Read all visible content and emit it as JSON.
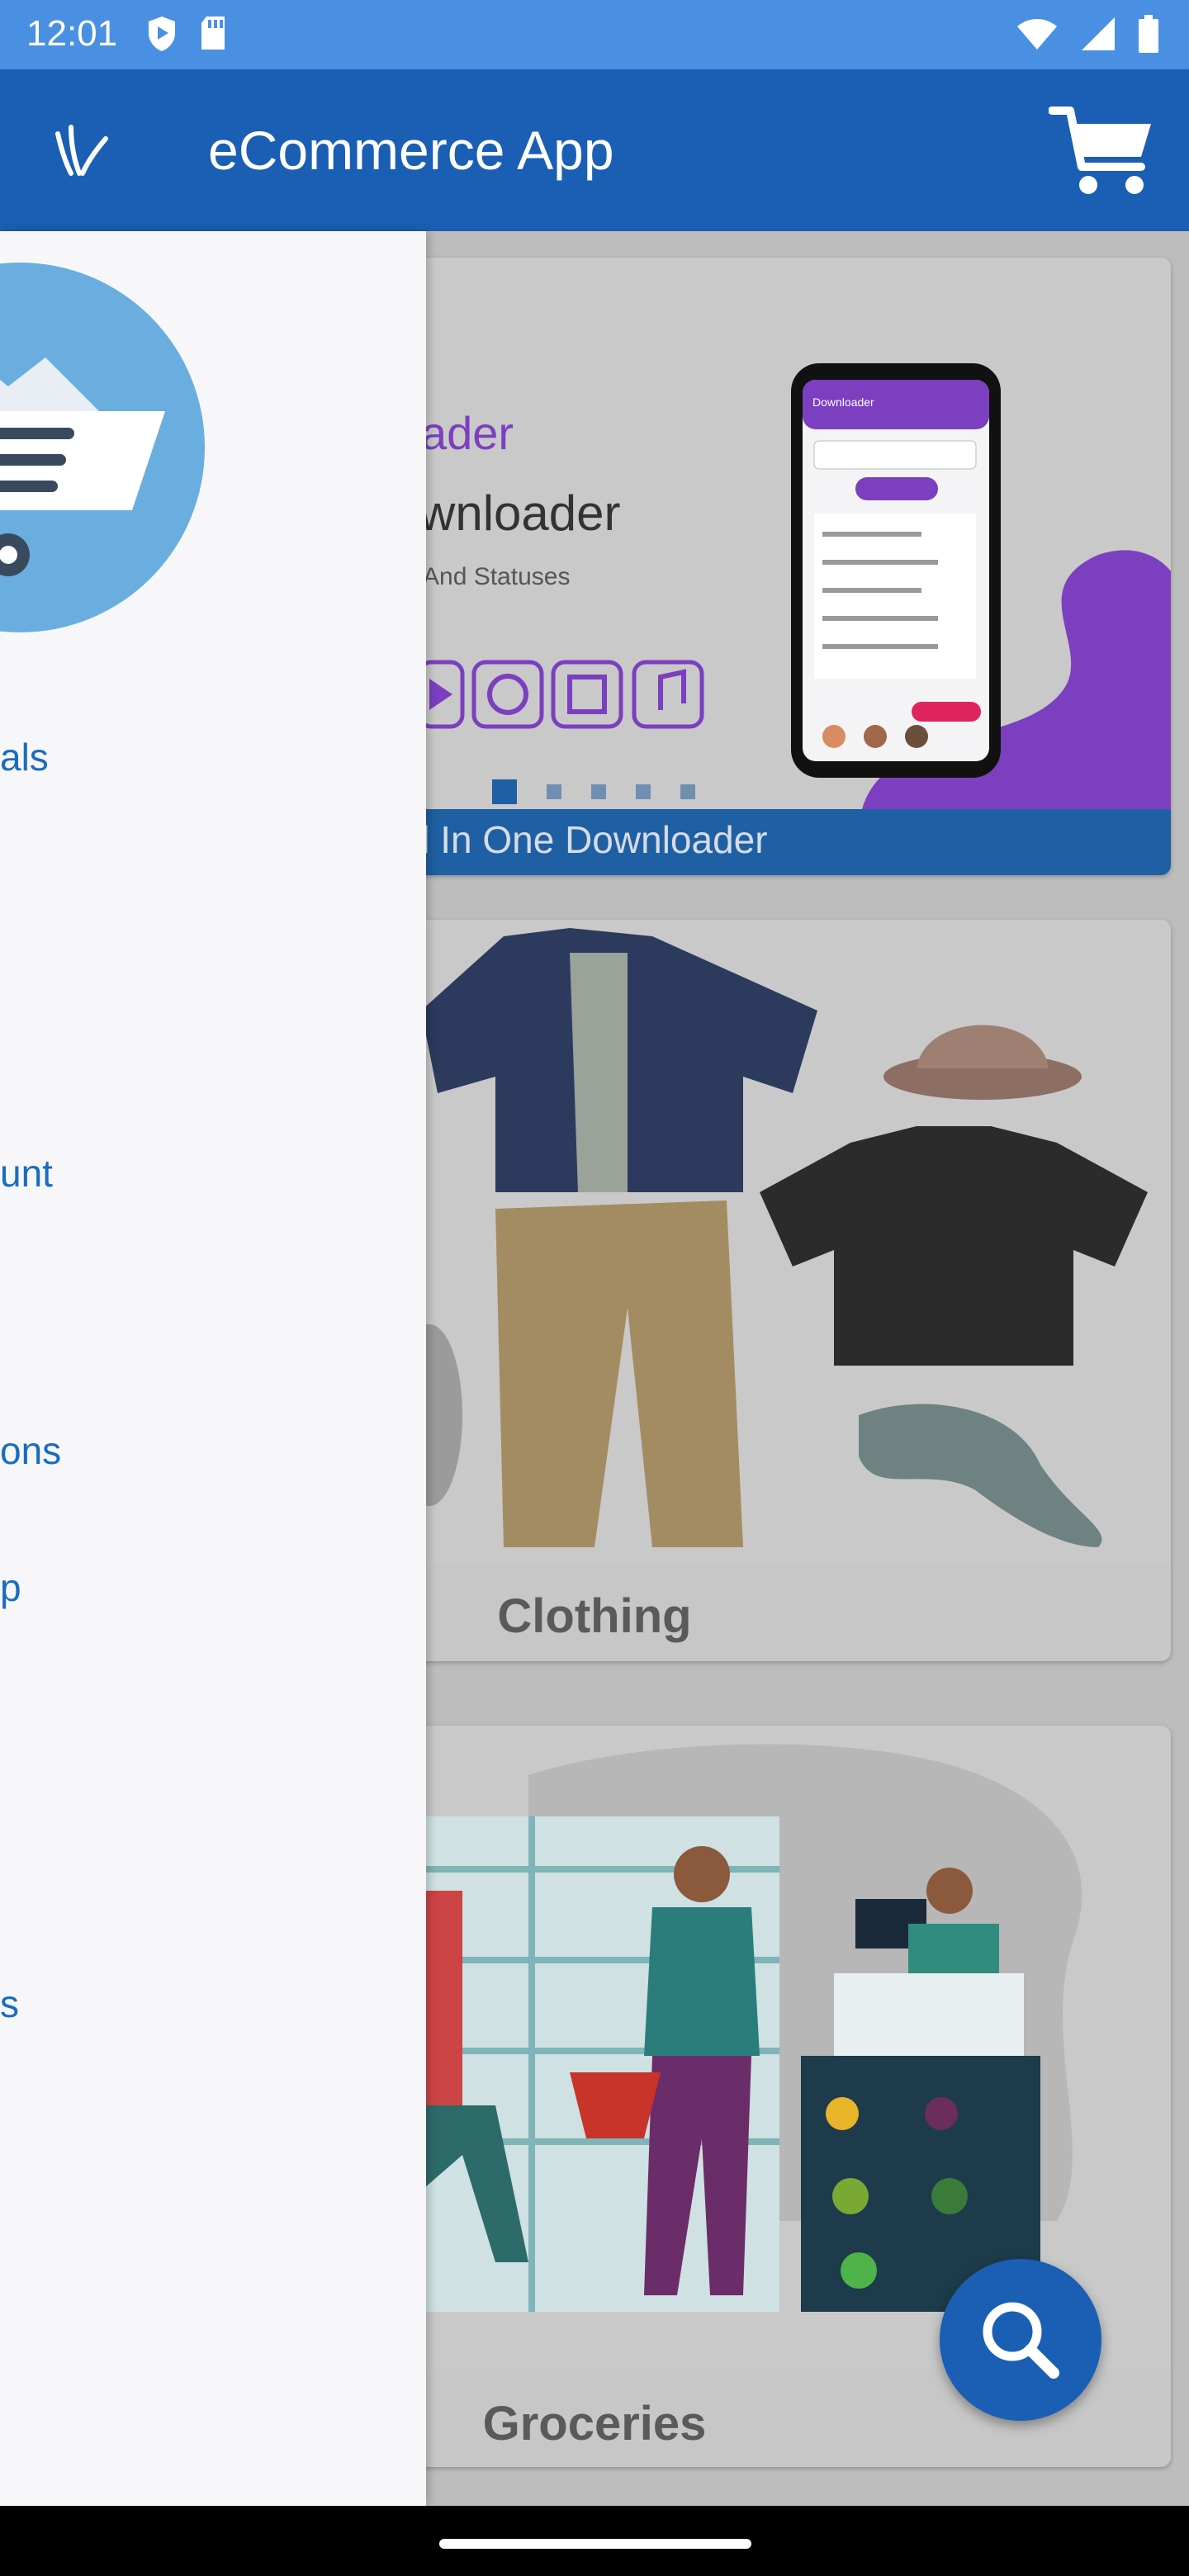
{
  "status_bar": {
    "time": "12:01",
    "left_icons": [
      "shield-play-icon",
      "sd-card-icon"
    ],
    "right_icons": [
      "wifi-icon",
      "signal-icon",
      "battery-icon"
    ]
  },
  "app_bar": {
    "title": "eCommerce App",
    "menu_icon": "logo-menu-icon",
    "cart_icon": "cart-icon",
    "color": "#1a5fb4"
  },
  "banner": {
    "title_partial": "ader",
    "subtitle_partial": "wnloader",
    "tagline_partial": "And Statuses",
    "caption": "ll In One Downloader",
    "dots": 5,
    "active_dot": 0,
    "phone_header": "Downloader"
  },
  "categories": [
    {
      "label": "Clothing"
    },
    {
      "label": "Groceries"
    }
  ],
  "drawer": {
    "items": [
      {
        "label": "als"
      },
      {
        "label": "unt"
      },
      {
        "label": "ons"
      },
      {
        "label": "p"
      },
      {
        "label": "s"
      }
    ]
  },
  "fab": {
    "icon": "search-icon"
  },
  "colors": {
    "primary": "#1a5fb4",
    "status_bar": "#4a90e2",
    "drawer_text": "#1a6cc0",
    "scrim": "#bdbdbd"
  }
}
